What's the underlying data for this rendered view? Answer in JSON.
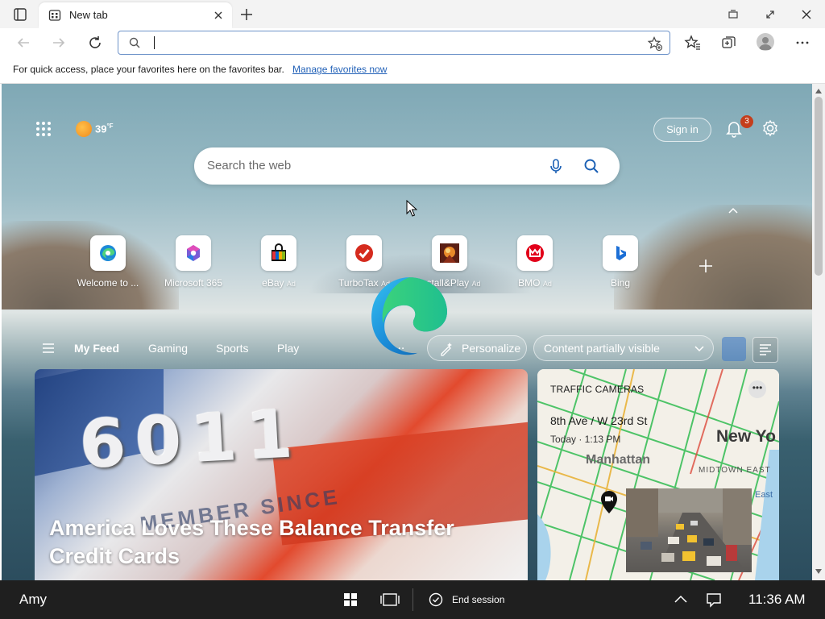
{
  "tab": {
    "title": "New tab"
  },
  "address": {
    "value": ""
  },
  "favorites_bar": {
    "message": "For quick access, place your favorites here on the favorites bar.",
    "link": "Manage favorites now"
  },
  "weather": {
    "temp": "39",
    "unit": "°F"
  },
  "header": {
    "signin": "Sign in",
    "notification_count": "3"
  },
  "search": {
    "placeholder": "Search the web"
  },
  "quick_links": [
    {
      "label": "Welcome to ...",
      "ad": ""
    },
    {
      "label": "Microsoft 365",
      "ad": ""
    },
    {
      "label": "eBay",
      "ad": "Ad"
    },
    {
      "label": "TurboTax",
      "ad": "Ad"
    },
    {
      "label": "Install&Play",
      "ad": "Ad"
    },
    {
      "label": "BMO",
      "ad": "Ad"
    },
    {
      "label": "Bing",
      "ad": ""
    }
  ],
  "feed": {
    "tabs": [
      "My Feed",
      "Gaming",
      "Sports",
      "Play"
    ],
    "more": "...",
    "personalize": "Personalize",
    "visibility": "Content partially visible"
  },
  "hero": {
    "title": "America Loves These Balance Transfer Credit Cards",
    "card_text": "6011",
    "card_small": "MEMBER SINCE"
  },
  "traffic": {
    "header": "TRAFFIC CAMERAS",
    "location": "8th Ave / W 23rd St",
    "time": "Today · 1:13 PM",
    "map_city": "New Yo",
    "map_boro": "Manhattan",
    "map_mid": "MIDTOWN EAST",
    "map_east": "East"
  },
  "taskbar": {
    "user": "Amy",
    "end_session": "End session",
    "clock": "11:36 AM"
  },
  "colors": {
    "accent": "#2362b8",
    "badge": "#c43e1c",
    "taskbar": "#1f1f1f"
  }
}
